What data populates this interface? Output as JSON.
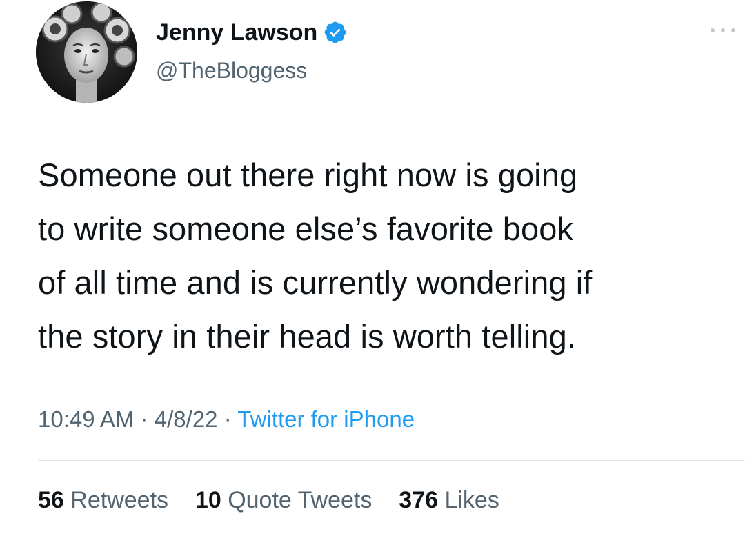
{
  "author": {
    "display_name": "Jenny Lawson",
    "handle": "@TheBloggess",
    "verified_icon": "verified-badge-icon",
    "avatar_icon": "profile-avatar"
  },
  "tweet": {
    "lines": [
      "Someone out there right now is going",
      "to write someone else’s favorite book",
      "of all time and is currently wondering if",
      "the story in their head is worth telling."
    ]
  },
  "meta": {
    "time": "10:49 AM",
    "sep1": "·",
    "date": "4/8/22",
    "sep2": "·",
    "source": "Twitter for iPhone"
  },
  "stats": {
    "retweets": {
      "count": "56",
      "label": "Retweets"
    },
    "quotes": {
      "count": "10",
      "label": "Quote Tweets"
    },
    "likes": {
      "count": "376",
      "label": "Likes"
    }
  },
  "colors": {
    "text": "#0f1419",
    "secondary": "#536471",
    "link": "#1d9bf0",
    "verified": "#1d9bf0"
  },
  "more_icon": "more-options-icon"
}
